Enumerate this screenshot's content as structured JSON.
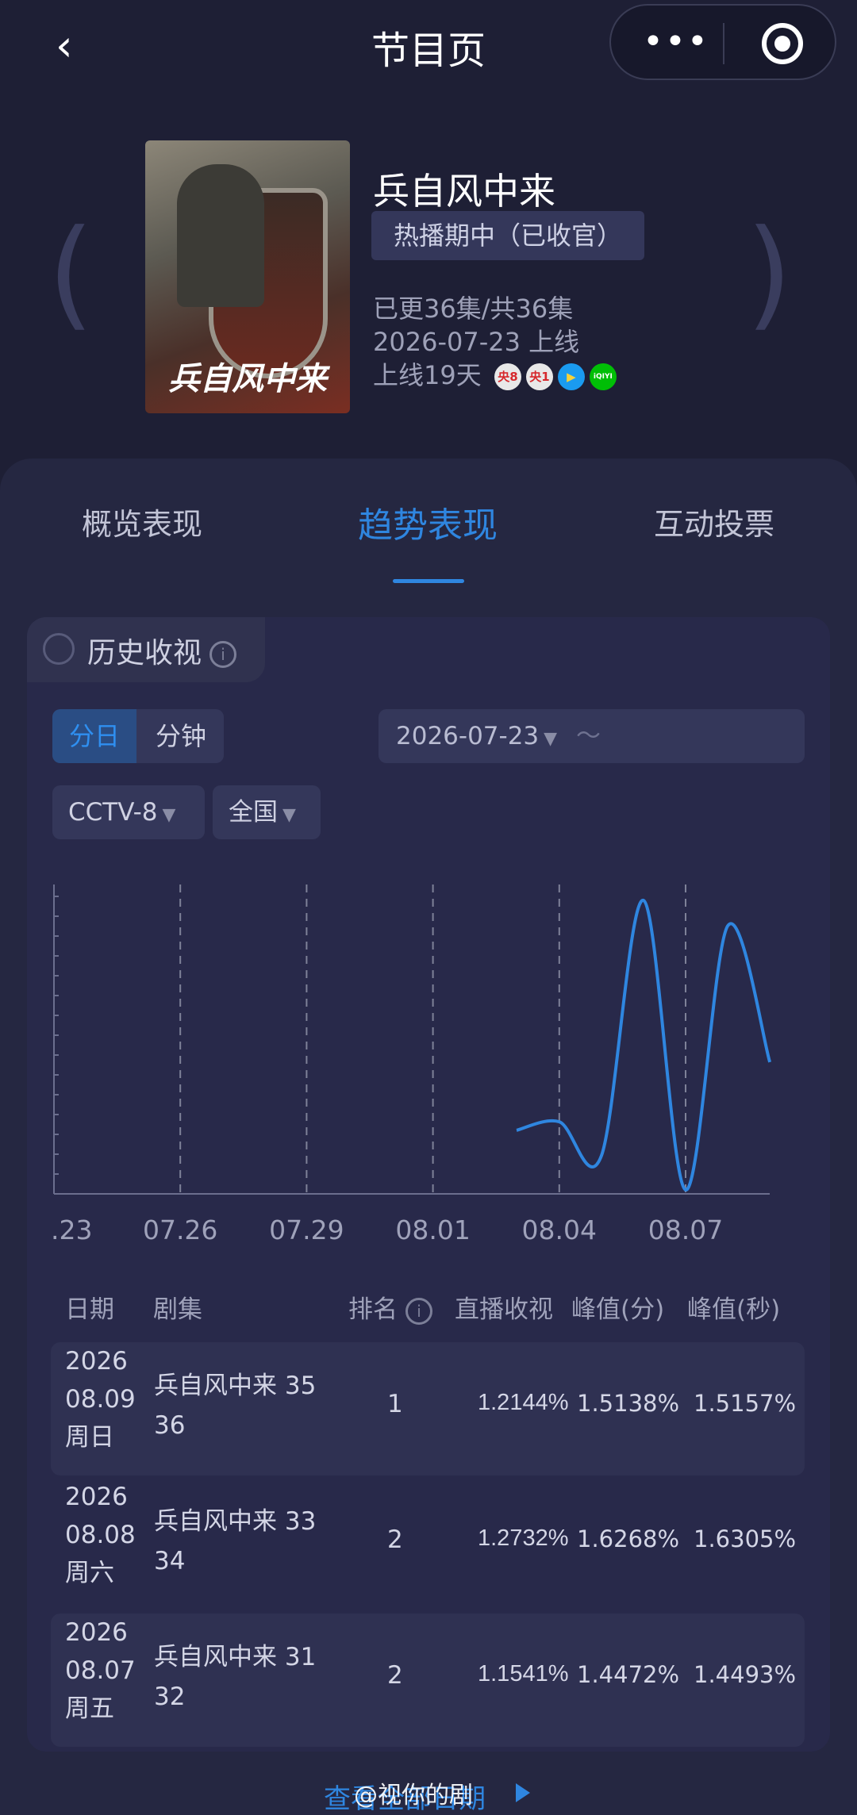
{
  "nav": {
    "title": "节目页",
    "back_icon": "‹",
    "more_icon": "•••"
  },
  "show": {
    "title": "兵自风中来",
    "poster_title": "兵自风中来",
    "status": "热播期中（已收官）",
    "episodes": "已更36集/共36集",
    "premiere": "2026-07-23 上线",
    "days_online": "上线19天",
    "platforms": [
      {
        "label": "央8",
        "color": "#e8e8e8",
        "text": "#d6282c"
      },
      {
        "label": "央1",
        "color": "#e8e8e8",
        "text": "#d6282c"
      },
      {
        "label": "▶",
        "color": "#1a9bf0",
        "text": "#f6d23a"
      },
      {
        "label": "iQIYI",
        "color": "#00be06",
        "text": "#ffffff"
      }
    ]
  },
  "tabs": [
    {
      "label": "概览表现",
      "active": false
    },
    {
      "label": "趋势表现",
      "active": true
    },
    {
      "label": "互动投票",
      "active": false
    }
  ],
  "section": {
    "title": "历史收视",
    "info_icon": "i"
  },
  "filters": {
    "granularity": [
      "分日",
      "分钟"
    ],
    "date_start": "2026-07-23",
    "date_sep": "～",
    "channel": "CCTV-8",
    "region": "全国"
  },
  "chart_data": {
    "type": "line",
    "x_ticks": [
      ".23",
      "07.26",
      "07.29",
      "08.01",
      "08.04",
      "08.07"
    ],
    "series": [
      {
        "color": "#2f86e0",
        "x": [
          "08.03",
          "08.04",
          "08.05",
          "08.06",
          "08.07",
          "08.08",
          "08.09"
        ],
        "values": [
          1.16,
          1.17,
          1.13,
          1.43,
          1.09,
          1.4,
          1.24
        ]
      }
    ],
    "grid": "vertical dashed"
  },
  "table": {
    "headers": [
      "日期",
      "剧集",
      "排名",
      "直播收视",
      "峰值(分)",
      "峰值(秒)"
    ],
    "rows": [
      {
        "year": "2026",
        "date": "08.09",
        "weekday": "周日",
        "ep1": "兵自风中来 35",
        "ep2": "36",
        "rank": "1",
        "live": "1.2144%",
        "peak_min": "1.5138%",
        "peak_sec": "1.5157%"
      },
      {
        "year": "2026",
        "date": "08.08",
        "weekday": "周六",
        "ep1": "兵自风中来 33",
        "ep2": "34",
        "rank": "2",
        "live": "1.2732%",
        "peak_min": "1.6268%",
        "peak_sec": "1.6305%"
      },
      {
        "year": "2026",
        "date": "08.07",
        "weekday": "周五",
        "ep1": "兵自风中来 31",
        "ep2": "32",
        "rank": "2",
        "live": "1.1541%",
        "peak_min": "1.4472%",
        "peak_sec": "1.4493%"
      }
    ]
  },
  "footer": {
    "link": "查看全部日期",
    "watermark": "@视你的剧"
  }
}
